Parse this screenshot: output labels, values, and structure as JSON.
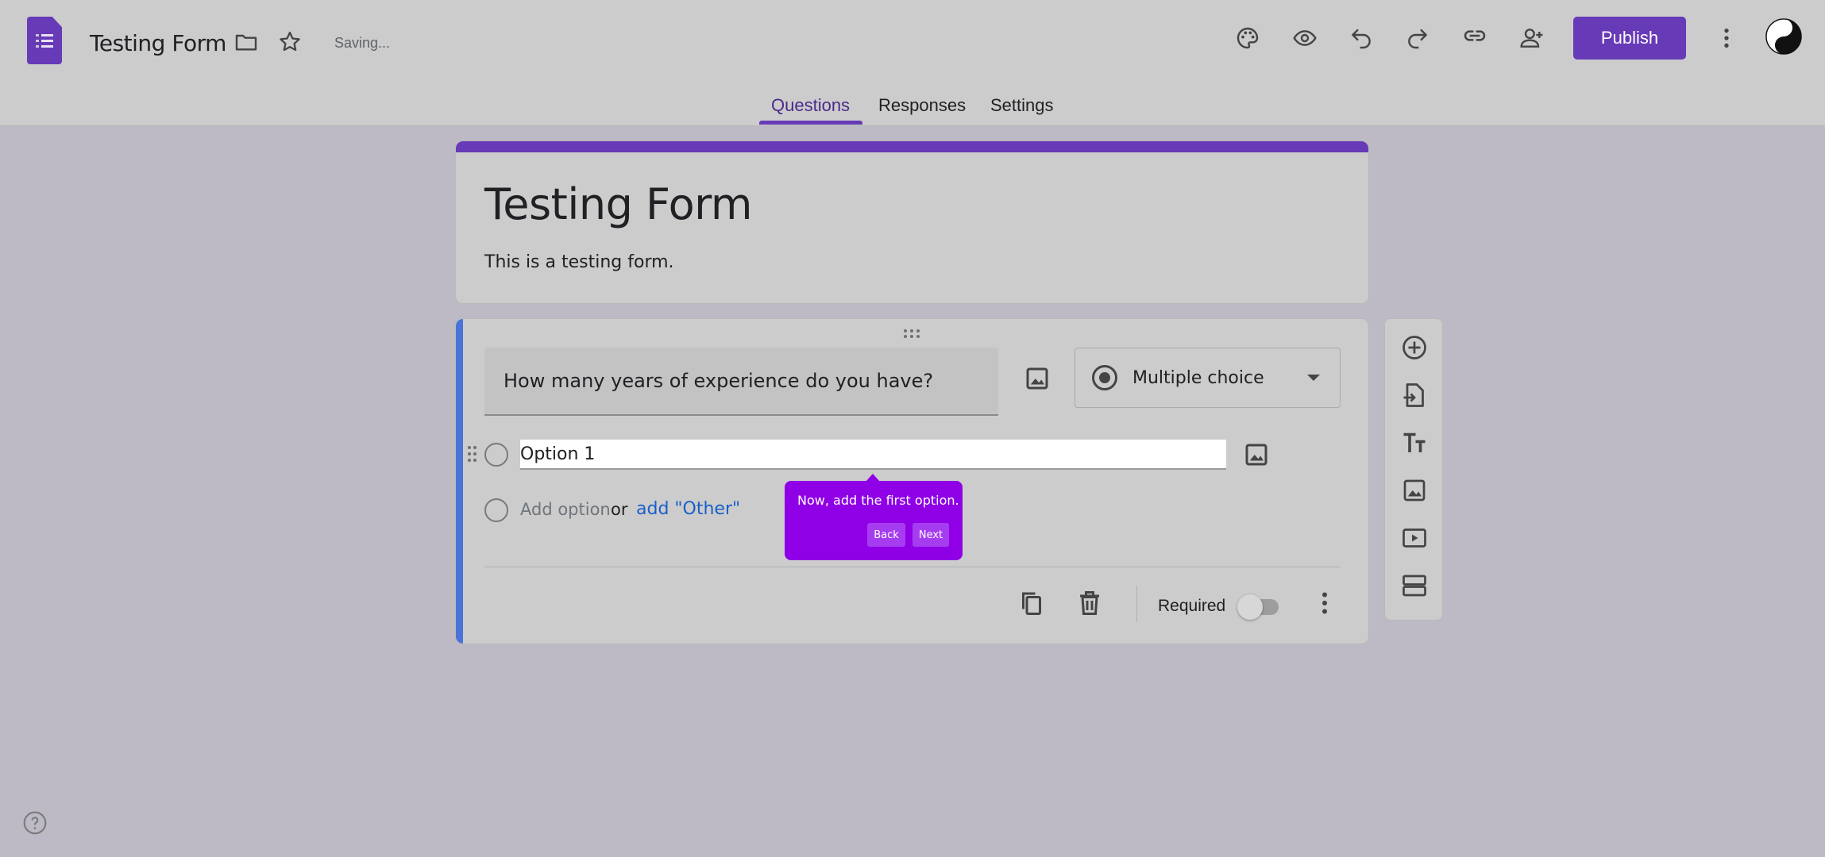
{
  "app": {
    "doc_title": "Testing Form",
    "status": "Saving...",
    "publish_label": "Publish",
    "brand_color": "#673ab7"
  },
  "toolbar_icons": [
    "folder-icon",
    "star-icon",
    "palette-icon",
    "eye-icon",
    "undo-icon",
    "redo-icon",
    "link-icon",
    "add-person-icon",
    "more-vert-icon"
  ],
  "tabs": [
    {
      "label": "Questions",
      "active": true
    },
    {
      "label": "Responses",
      "active": false
    },
    {
      "label": "Settings",
      "active": false
    }
  ],
  "form": {
    "title": "Testing Form",
    "description": "This is a testing form."
  },
  "question": {
    "text": "How many years of experience do you have?",
    "type": "Multiple choice",
    "options": [
      "Option 1"
    ],
    "add_option": "Add option",
    "or": "or",
    "add_other": "add \"Other\"",
    "required_label": "Required",
    "required": false
  },
  "tooltip": {
    "text": "Now, add the first option.",
    "back": "Back",
    "next": "Next"
  },
  "side_toolbar": [
    "add-question-icon",
    "import-questions-icon",
    "add-title-icon",
    "add-image-icon",
    "add-video-icon",
    "add-section-icon"
  ]
}
